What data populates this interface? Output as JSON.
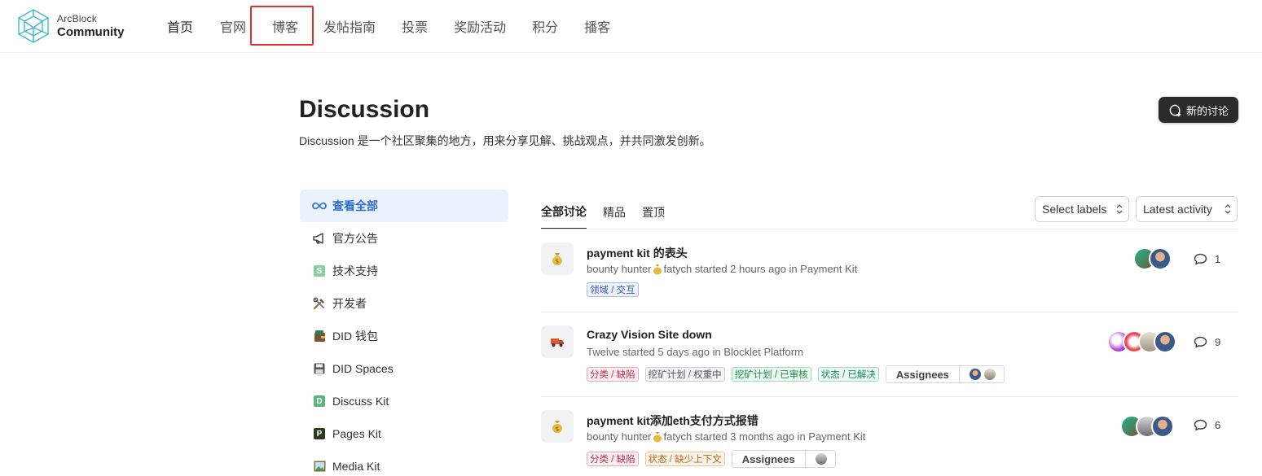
{
  "brand": {
    "small": "ArcBlock",
    "big": "Community"
  },
  "nav": [
    "首页",
    "官网",
    "博客",
    "发帖指南",
    "投票",
    "奖励活动",
    "积分",
    "播客"
  ],
  "page": {
    "title": "Discussion",
    "description": "Discussion 是一个社区聚集的地方，用来分享见解、挑战观点，并共同激发创新。",
    "new_button": "新的讨论"
  },
  "sidebar": [
    {
      "label": "查看全部",
      "icon": "infinity-icon"
    },
    {
      "label": "官方公告",
      "icon": "megaphone-icon"
    },
    {
      "label": "技术支持",
      "icon": "letter-s-icon"
    },
    {
      "label": "开发者",
      "icon": "tools-icon"
    },
    {
      "label": "DID 钱包",
      "icon": "wallet-icon"
    },
    {
      "label": "DID Spaces",
      "icon": "floppy-disk-icon"
    },
    {
      "label": "Discuss Kit",
      "icon": "letter-d-icon"
    },
    {
      "label": "Pages Kit",
      "icon": "letter-p-icon"
    },
    {
      "label": "Media Kit",
      "icon": "picture-icon"
    }
  ],
  "tabs": [
    "全部讨论",
    "精品",
    "置顶"
  ],
  "filters": {
    "labels": "Select labels",
    "sort": "Latest activity"
  },
  "discussions": [
    {
      "title": "payment kit 的表头",
      "author": "bounty hunter",
      "meta": "fatych started 2 hours ago in Payment Kit",
      "tags": [
        "领域 / 交互"
      ],
      "comments": "1",
      "icon": "money-bag-icon"
    },
    {
      "title": "Crazy Vision Site down",
      "meta": "Twelve started 5 days ago in Blocklet Platform",
      "tags": [
        "分类 / 缺陷",
        "挖矿计划 / 权重中",
        "挖矿计划 / 已审核",
        "状态 / 已解决"
      ],
      "assignees": "Assignees",
      "comments": "9",
      "icon": "truck-icon"
    },
    {
      "title": "payment kit添加eth支付方式报错",
      "author": "bounty hunter",
      "meta": "fatych started 3 months ago in Payment Kit",
      "tags": [
        "分类 / 缺陷",
        "状态 / 缺少上下文"
      ],
      "assignees": "Assignees",
      "comments": "6",
      "icon": "money-bag-icon"
    }
  ],
  "colors": {
    "accent": "#2b6bd8",
    "nav_highlight": "#e03131",
    "button_dark": "#2b2b2b"
  }
}
